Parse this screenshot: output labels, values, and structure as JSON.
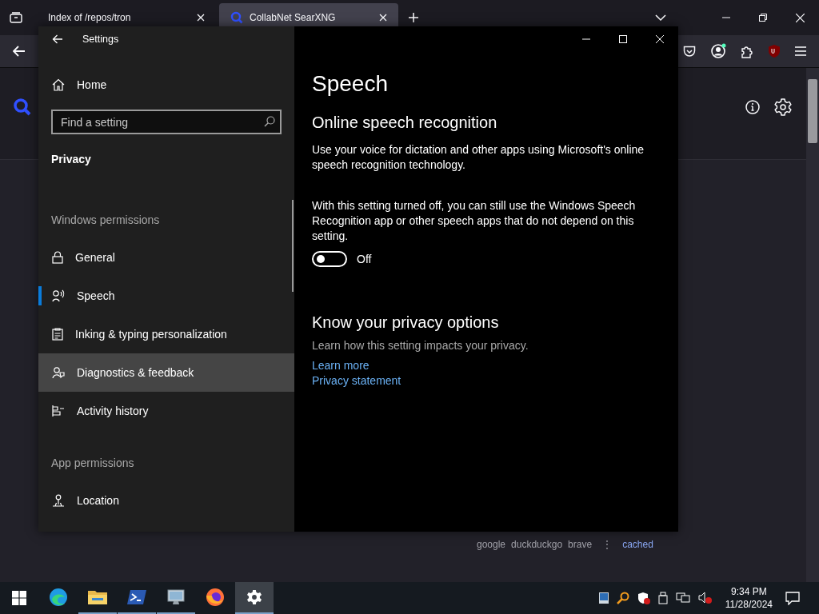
{
  "browser": {
    "tabs": [
      {
        "title": "Index of /repos/tron",
        "selected": false
      },
      {
        "title": "CollabNet SearXNG",
        "selected": true
      }
    ],
    "engines": [
      "google",
      "duckduckgo",
      "brave"
    ],
    "more": "⋮",
    "cached": "cached"
  },
  "settings": {
    "title": "Settings",
    "home": "Home",
    "search": {
      "placeholder": "Find a setting"
    },
    "section": "Privacy",
    "groups": [
      {
        "header": "Windows permissions",
        "items": [
          {
            "label": "General",
            "selected": false,
            "hovered": false
          },
          {
            "label": "Speech",
            "selected": true,
            "hovered": false
          },
          {
            "label": "Inking & typing personalization",
            "selected": false,
            "hovered": false
          },
          {
            "label": "Diagnostics & feedback",
            "selected": false,
            "hovered": true
          },
          {
            "label": "Activity history",
            "selected": false,
            "hovered": false
          }
        ]
      },
      {
        "header": "App permissions",
        "items": [
          {
            "label": "Location",
            "selected": false,
            "hovered": false
          }
        ]
      }
    ],
    "page": {
      "title": "Speech",
      "heading": "Online speech recognition",
      "paragraphs": [
        "Use your voice for dictation and other apps using Microsoft's online speech recognition technology.",
        "With this setting turned off, you can still use the Windows Speech Recognition app or other speech apps that do not depend on this setting."
      ],
      "toggle": {
        "on": false,
        "label": "Off"
      },
      "privacy": {
        "heading": "Know your privacy options",
        "text": "Learn how this setting impacts your privacy.",
        "links": [
          "Learn more",
          "Privacy statement"
        ]
      }
    }
  },
  "taskbar": {
    "apps": [
      {
        "kind": "edge",
        "running": false,
        "selected": false
      },
      {
        "kind": "folder",
        "running": true,
        "selected": false
      },
      {
        "kind": "terminal",
        "running": true,
        "selected": false
      },
      {
        "kind": "computer",
        "running": true,
        "selected": false
      },
      {
        "kind": "firefox",
        "running": false,
        "selected": false
      },
      {
        "kind": "gear",
        "running": true,
        "selected": true
      }
    ],
    "time": "9:34 PM",
    "date": "11/28/2024"
  }
}
